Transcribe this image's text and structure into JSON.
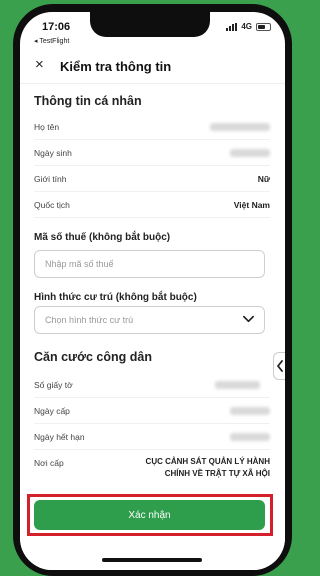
{
  "status": {
    "time": "17:06",
    "back_app": "◂ TestFlight",
    "network": "4G"
  },
  "header": {
    "close_glyph": "×",
    "title": "Kiểm tra thông tin"
  },
  "personal": {
    "title": "Thông tin cá nhân",
    "rows": [
      {
        "label": "Họ tên",
        "value": ""
      },
      {
        "label": "Ngày sinh",
        "value": ""
      },
      {
        "label": "Giới tính",
        "value": "Nữ"
      },
      {
        "label": "Quốc tịch",
        "value": "Việt Nam"
      }
    ]
  },
  "tax": {
    "label": "Mã số thuế (không bắt buộc)",
    "placeholder": "Nhập mã số thuế"
  },
  "residence": {
    "label": "Hình thức cư trú (không bắt buộc)",
    "placeholder": "Chọn hình thức cư trú"
  },
  "id_card": {
    "title": "Căn cước công dân",
    "rows": [
      {
        "label": "Số giấy tờ",
        "value": ""
      },
      {
        "label": "Ngày cấp",
        "value": ""
      },
      {
        "label": "Ngày hết hạn",
        "value": ""
      }
    ],
    "issuer_label": "Nơi cấp",
    "issuer_value": "CỤC CẢNH SÁT QUẢN LÝ HÀNH CHÍNH VỀ TRẬT TỰ XÃ HỘI"
  },
  "footer": {
    "confirm_label": "Xác nhận"
  },
  "colors": {
    "brand_green": "#2e9e4c",
    "highlight_red": "#d4202a",
    "background_green": "#3aa04d"
  }
}
